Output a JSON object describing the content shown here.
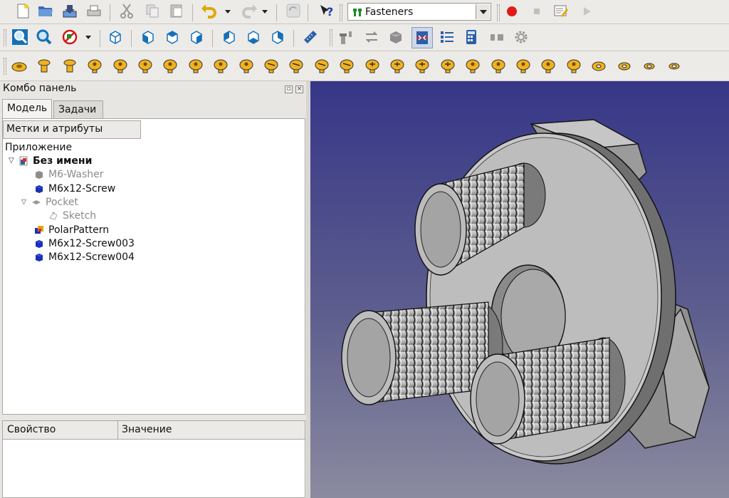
{
  "toolbar": {
    "workbench": "Fasteners"
  },
  "combo": {
    "title": "Комбо панель",
    "tabs": [
      "Модель",
      "Задачи"
    ],
    "labels_header": "Метки и атрибуты",
    "application": "Приложение",
    "tree": [
      {
        "label": "Без имени",
        "icon": "document-icon"
      },
      {
        "label": "M6-Washer",
        "icon": "solid-icon"
      },
      {
        "label": "M6x12-Screw",
        "icon": "solid-icon"
      },
      {
        "label": "Pocket",
        "icon": "pocket-icon"
      },
      {
        "label": "Sketch",
        "icon": "sketch-icon"
      },
      {
        "label": "PolarPattern",
        "icon": "polar-pattern-icon"
      },
      {
        "label": "M6x12-Screw003",
        "icon": "solid-icon"
      },
      {
        "label": "M6x12-Screw004",
        "icon": "solid-icon"
      }
    ],
    "property_col": "Свойство",
    "value_col": "Значение"
  },
  "colors": {
    "accent": "#1e2fd8",
    "fastener_gold": "#f2b21b",
    "viewport_top": "#363688",
    "viewport_bottom": "#8b8ba0"
  }
}
